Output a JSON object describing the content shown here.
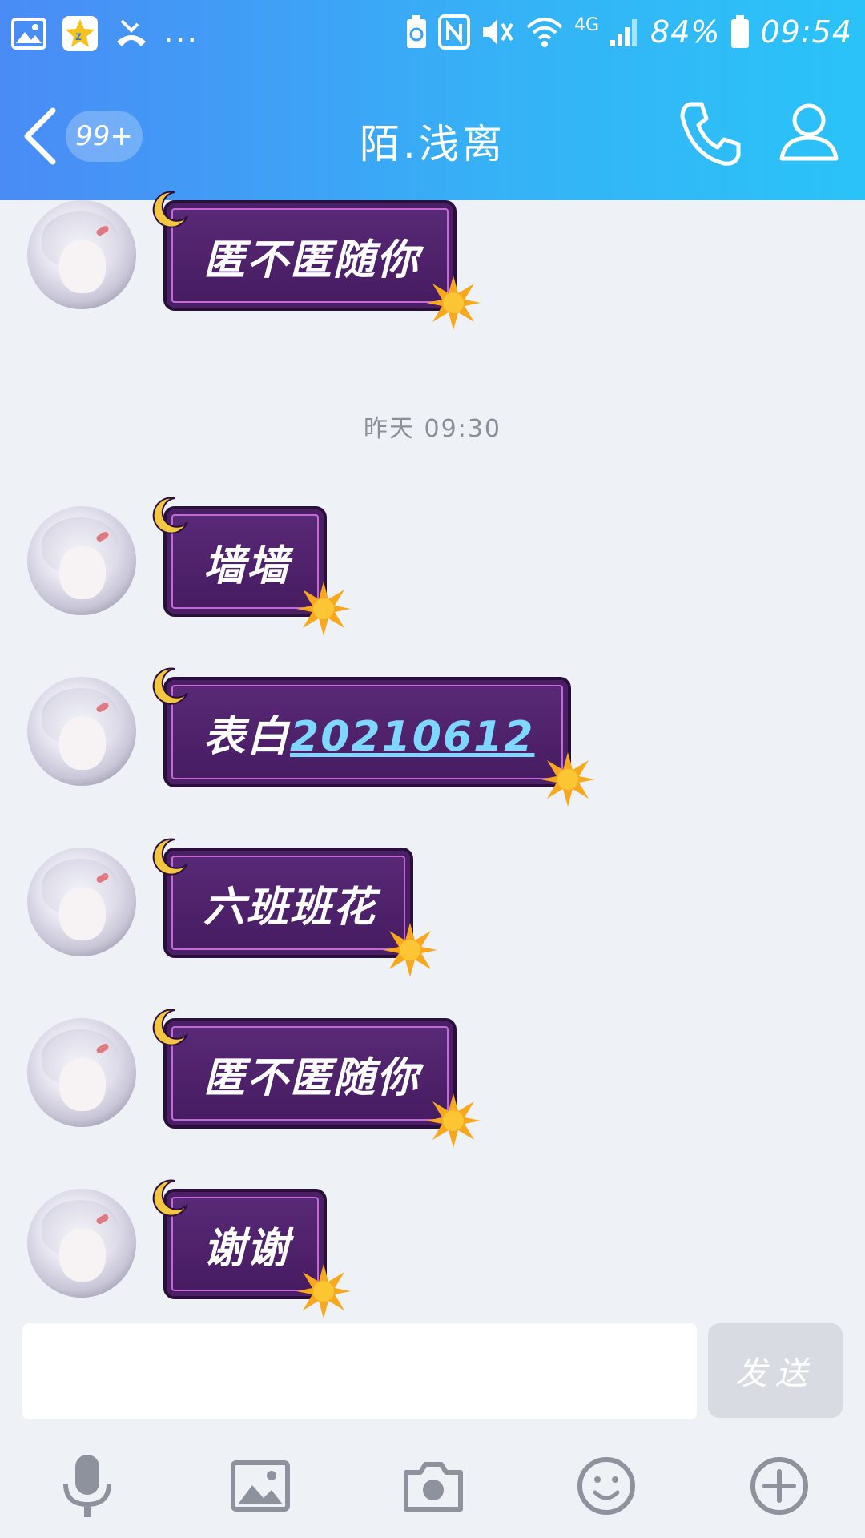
{
  "status_bar": {
    "battery": "84%",
    "time": "09:54",
    "network": "4G",
    "more": "..."
  },
  "header": {
    "unread_count": "99+",
    "title": "陌.浅离"
  },
  "messages": [
    {
      "text": "匿不匿随你"
    },
    {
      "text": "墙墙"
    },
    {
      "text": "表白",
      "link": "20210612"
    },
    {
      "text": "六班班花"
    },
    {
      "text": "匿不匿随你"
    },
    {
      "text": "谢谢"
    }
  ],
  "timestamp": "昨天 09:30",
  "input": {
    "placeholder": "",
    "send_label": "发送"
  },
  "toolbar": {
    "icons": [
      "microphone-icon",
      "image-icon",
      "camera-icon",
      "emoji-icon",
      "plus-icon"
    ]
  },
  "colors": {
    "header_start": "#4a8bf6",
    "header_end": "#2ac3f8",
    "bubble": "#4e2169",
    "background": "#eef1f6",
    "link": "#7dd7ff"
  }
}
